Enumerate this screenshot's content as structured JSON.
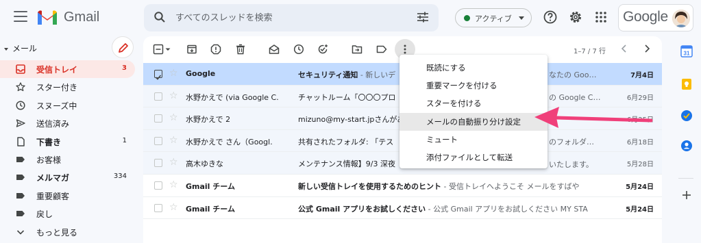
{
  "header": {
    "brand": "Gmail",
    "search_placeholder": "すべてのスレッドを検索",
    "status": "アクティブ",
    "google_logo_text": "Google"
  },
  "sidebar": {
    "section": "メール",
    "items": [
      {
        "label": "受信トレイ",
        "count": "3",
        "icon": "inbox-icon",
        "active": true,
        "bold": true
      },
      {
        "label": "スター付き",
        "count": "",
        "icon": "star-icon"
      },
      {
        "label": "スヌーズ中",
        "count": "",
        "icon": "clock-icon"
      },
      {
        "label": "送信済み",
        "count": "",
        "icon": "send-icon"
      },
      {
        "label": "下書き",
        "count": "1",
        "icon": "draft-icon",
        "bold": true
      },
      {
        "label": "お客様",
        "count": "",
        "icon": "label-icon"
      },
      {
        "label": "メルマガ",
        "count": "334",
        "icon": "label-icon",
        "bold": true
      },
      {
        "label": "重要顧客",
        "count": "",
        "icon": "label-icon"
      },
      {
        "label": "戻し",
        "count": "",
        "icon": "label-icon"
      },
      {
        "label": "もっと見る",
        "count": "",
        "icon": "chevron-down-icon"
      }
    ]
  },
  "toolbar": {
    "pager": "1–7 / 7 行"
  },
  "emails": [
    {
      "sender": "Google",
      "subject": "セキュリティ通知",
      "snippet": " - 新しいデ",
      "date": "7月4日",
      "state": "selected"
    },
    {
      "sender": "水野かえで (via Google C.",
      "subject": "チャットルーム「〇〇〇プロ",
      "snippet": "",
      "date": "6月29日",
      "state": "read"
    },
    {
      "sender": "水野かえで 2",
      "subject": "mizuno@my-start.jpさんがあ",
      "snippet": "",
      "date": "6月25日",
      "state": "read"
    },
    {
      "sender": "水野かえで さん（Googl.",
      "subject": "共有されたフォルダ: 「テス",
      "snippet": "",
      "date": "6月18日",
      "state": "read"
    },
    {
      "sender": "高木ゆきな",
      "subject": "メンテナンス情報】9/3 深夜",
      "snippet": "",
      "date": "5月28日",
      "state": "read"
    },
    {
      "sender": "Gmail チーム",
      "subject": "新しい受信トレイを使用するためのヒント",
      "snippet": " - 受信トレイへようこそ メールをすばや",
      "date": "5月24日",
      "state": "unread"
    },
    {
      "sender": "Gmail チーム",
      "subject": "公式 Gmail アプリをお試しください",
      "snippet": " - 公式 Gmail アプリをお試しください MY STA",
      "date": "5月24日",
      "state": "unread"
    }
  ],
  "right_fragments": [
    "なたの Goo…",
    "の Google C…",
    "",
    "のフォルダ…",
    "いたします。",
    "",
    ""
  ],
  "menu": {
    "items": [
      "既読にする",
      "重要マークを付ける",
      "スターを付ける",
      "メールの自動振り分け設定",
      "ミュート",
      "添付ファイルとして転送"
    ],
    "highlighted_index": 3
  },
  "colors": {
    "accent_red": "#d93025",
    "arrow_pink": "#f0407a",
    "selected_row": "#c2dbff"
  }
}
